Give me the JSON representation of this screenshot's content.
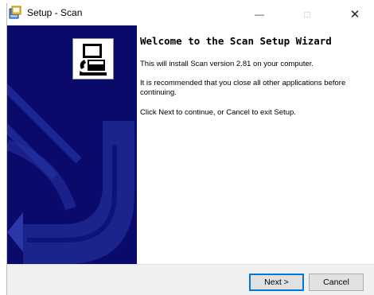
{
  "window": {
    "title": "Setup - Scan",
    "minimize_glyph": "—",
    "maximize_glyph": "□",
    "close_glyph": "✕"
  },
  "wizard": {
    "heading": "Welcome to the Scan Setup Wizard",
    "paragraphs": [
      "This will install Scan version 2.81 on your computer.",
      "It is recommended that you close all other applications before continuing.",
      "Click Next to continue, or Cancel to exit Setup."
    ]
  },
  "buttons": {
    "next": "Next >",
    "cancel": "Cancel"
  },
  "icons": {
    "app": "setup-installer-icon",
    "logo": "computer-installer-icon"
  },
  "colors": {
    "panel": "#0a0a6b",
    "accent": "#0078d7"
  }
}
